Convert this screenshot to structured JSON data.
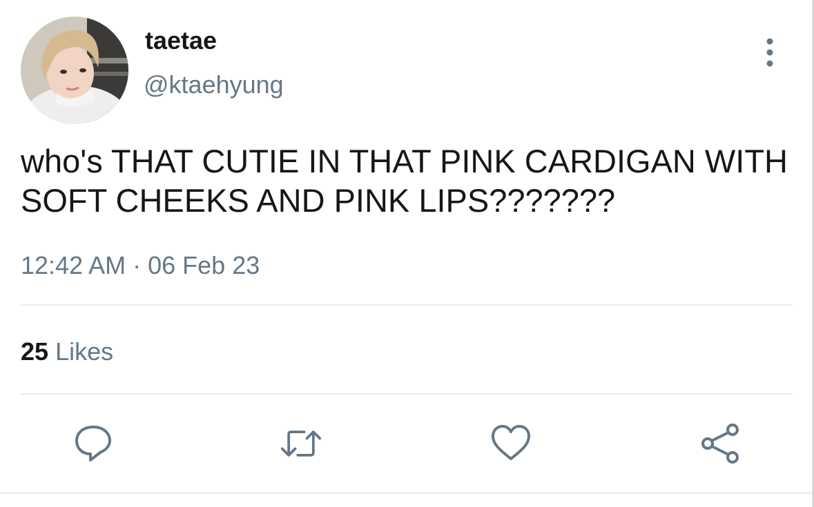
{
  "author": {
    "display_name": "taetae",
    "handle": "@ktaehyung"
  },
  "tweet": {
    "text": "who's THAT CUTIE IN THAT PINK CARDIGAN WITH SOFT CHEEKS AND PINK LIPS???????",
    "time": "12:42 AM",
    "separator": " · ",
    "date": "06 Feb 23"
  },
  "stats": {
    "likes_count": "25",
    "likes_label": "Likes"
  },
  "actions": {
    "reply_icon": "speech-bubble-icon",
    "retweet_icon": "retweet-arrows-icon",
    "like_icon": "heart-icon",
    "share_icon": "share-nodes-icon",
    "more_icon": "vertical-ellipsis-icon"
  },
  "colors": {
    "text": "#14171a",
    "secondary": "#657786",
    "divider": "#e6ecf0"
  }
}
